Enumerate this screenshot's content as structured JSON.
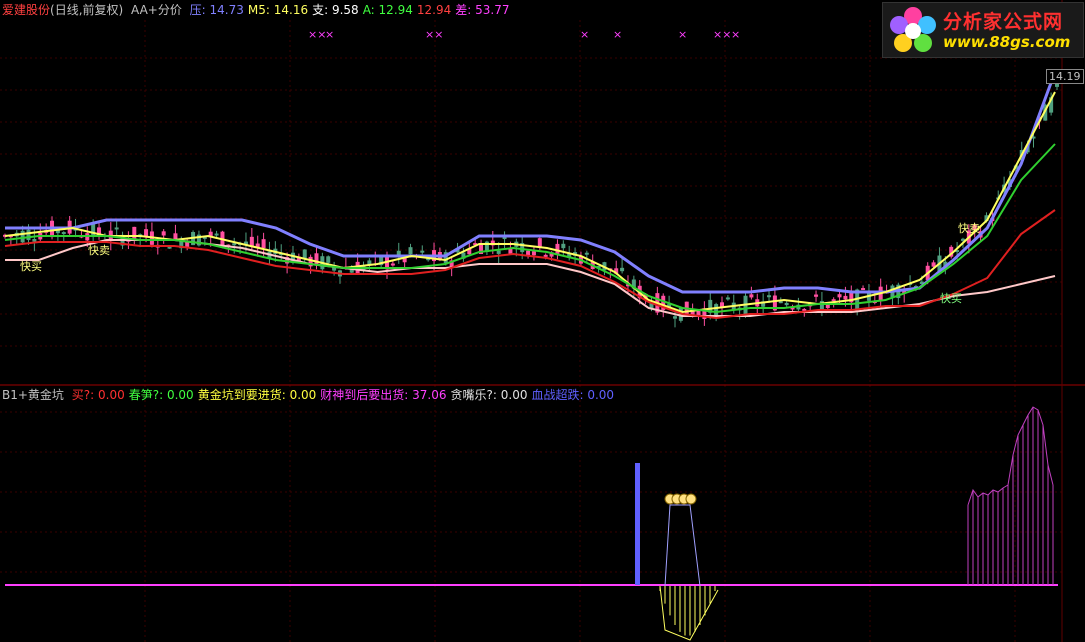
{
  "header": {
    "stock_name": "爱建股份",
    "period": "(日线,前复权)",
    "indicator": "AA+分价",
    "items": [
      {
        "label": "压:",
        "value": "14.73",
        "color": "#8080ff"
      },
      {
        "label": "M5:",
        "value": "14.16",
        "color": "#ffff60"
      },
      {
        "label": "支:",
        "value": "9.58",
        "color": "#ffffff"
      },
      {
        "label": "A:",
        "value": "12.94",
        "color": "#40ff40"
      },
      {
        "label": "",
        "value": "12.94",
        "color": "#ff4040"
      },
      {
        "label": "差:",
        "value": "53.77",
        "color": "#ff40ff"
      }
    ]
  },
  "indicator_header": {
    "name": "B1+黄金坑",
    "items": [
      {
        "label": "买?:",
        "value": "0.00",
        "color": "#ff3030"
      },
      {
        "label": "春笋?:",
        "value": "0.00",
        "color": "#40ff40"
      },
      {
        "label": "黄金坑到要进货:",
        "value": "0.00",
        "color": "#ffff40"
      },
      {
        "label": "财神到后要出货:",
        "value": "37.06",
        "color": "#ff40ff"
      },
      {
        "label": "贪嘴乐?:",
        "value": "0.00",
        "color": "#e0e0e0"
      },
      {
        "label": "血战超跌:",
        "value": "0.00",
        "color": "#6060ff"
      }
    ]
  },
  "logo": {
    "title": "分析家公式网",
    "url": "www.88gs.com"
  },
  "price_tag": "14.19",
  "chart_labels": {
    "sell_tag": "快卖",
    "buy_tag": "快买"
  },
  "colors": {
    "background": "#000000",
    "up_candle": "#ff50a0",
    "down_candle": "#50a080",
    "pressure_line": "#8080ff",
    "support_line": "#ffc8c8",
    "ma_green": "#30d030",
    "ma_red": "#e02020",
    "ma_yellow": "#ffff60",
    "grid": "#3a0000"
  },
  "chart_data": {
    "type": "line",
    "title": "爱建股份",
    "ylim": [
      7.5,
      15.0
    ],
    "series": [
      {
        "name": "压",
        "values": [
          10.8,
          10.8,
          10.8,
          11.0,
          11.0,
          11.0,
          11.0,
          11.0,
          10.8,
          10.4,
          10.1,
          10.1,
          10.1,
          10.1,
          10.6,
          10.6,
          10.6,
          10.5,
          10.2,
          9.6,
          9.2,
          9.2,
          9.2,
          9.3,
          9.3,
          9.2,
          9.2,
          9.3,
          10.0,
          10.8,
          12.4,
          14.7
        ]
      },
      {
        "name": "M5",
        "values": [
          10.6,
          10.7,
          10.8,
          10.6,
          10.6,
          10.5,
          10.6,
          10.4,
          10.2,
          10.0,
          9.8,
          9.9,
          10.1,
          10.0,
          10.4,
          10.4,
          10.3,
          10.1,
          9.7,
          9.0,
          8.7,
          8.8,
          8.9,
          9.0,
          8.9,
          9.0,
          9.2,
          9.5,
          10.2,
          11.0,
          12.6,
          14.2
        ]
      },
      {
        "name": "支",
        "values": [
          10.0,
          10.0,
          10.3,
          10.5,
          10.5,
          10.5,
          10.4,
          10.3,
          10.1,
          9.9,
          9.8,
          9.7,
          9.8,
          9.8,
          9.9,
          9.9,
          9.9,
          9.7,
          9.4,
          8.8,
          8.6,
          8.6,
          8.6,
          8.7,
          8.7,
          8.7,
          8.8,
          8.9,
          9.1,
          9.2,
          9.4,
          9.6
        ]
      },
      {
        "name": "A",
        "values": [
          10.5,
          10.6,
          10.6,
          10.6,
          10.5,
          10.5,
          10.4,
          10.2,
          10.0,
          9.9,
          9.8,
          9.8,
          9.8,
          9.9,
          10.2,
          10.3,
          10.2,
          10.0,
          9.6,
          9.1,
          8.8,
          8.7,
          8.8,
          8.8,
          8.9,
          8.9,
          9.0,
          9.3,
          9.9,
          10.6,
          12.0,
          12.9
        ]
      }
    ],
    "indicator": {
      "name": "B1+黄金坑",
      "财神到后要出货": 37.06
    }
  }
}
